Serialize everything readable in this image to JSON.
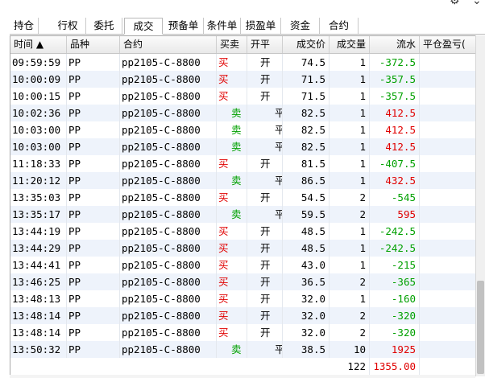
{
  "window_icons": [
    "gear-icon",
    "chevron-down-icon"
  ],
  "tabs": [
    {
      "label": "持仓",
      "active": false
    },
    {
      "label": "行权",
      "active": false
    },
    {
      "label": "委托",
      "active": false
    },
    {
      "label": "成交",
      "active": true
    },
    {
      "label": "预备单",
      "active": false
    },
    {
      "label": "条件单",
      "active": false
    },
    {
      "label": "损盈单",
      "active": false
    },
    {
      "label": "资金",
      "active": false
    },
    {
      "label": "合约",
      "active": false
    }
  ],
  "columns": [
    "时间 ▲",
    "品种",
    "合约",
    "买卖",
    "开平",
    "成交价",
    "成交量",
    "流水",
    "平仓盈亏("
  ],
  "rows": [
    {
      "time": "09:59:59",
      "product": "PP",
      "contract": "pp2105-C-8800",
      "side": "买",
      "openclose": "开",
      "price": "74.5",
      "qty": "1",
      "flow": "-372.5"
    },
    {
      "time": "10:00:09",
      "product": "PP",
      "contract": "pp2105-C-8800",
      "side": "买",
      "openclose": "开",
      "price": "71.5",
      "qty": "1",
      "flow": "-357.5"
    },
    {
      "time": "10:00:15",
      "product": "PP",
      "contract": "pp2105-C-8800",
      "side": "买",
      "openclose": "开",
      "price": "71.5",
      "qty": "1",
      "flow": "-357.5"
    },
    {
      "time": "10:02:36",
      "product": "PP",
      "contract": "pp2105-C-8800",
      "side": "卖",
      "openclose": "平",
      "price": "82.5",
      "qty": "1",
      "flow": "412.5"
    },
    {
      "time": "10:03:00",
      "product": "PP",
      "contract": "pp2105-C-8800",
      "side": "卖",
      "openclose": "平",
      "price": "82.5",
      "qty": "1",
      "flow": "412.5"
    },
    {
      "time": "10:03:00",
      "product": "PP",
      "contract": "pp2105-C-8800",
      "side": "卖",
      "openclose": "平",
      "price": "82.5",
      "qty": "1",
      "flow": "412.5"
    },
    {
      "time": "11:18:33",
      "product": "PP",
      "contract": "pp2105-C-8800",
      "side": "买",
      "openclose": "开",
      "price": "81.5",
      "qty": "1",
      "flow": "-407.5"
    },
    {
      "time": "11:20:12",
      "product": "PP",
      "contract": "pp2105-C-8800",
      "side": "卖",
      "openclose": "平",
      "price": "86.5",
      "qty": "1",
      "flow": "432.5"
    },
    {
      "time": "13:35:03",
      "product": "PP",
      "contract": "pp2105-C-8800",
      "side": "买",
      "openclose": "开",
      "price": "54.5",
      "qty": "2",
      "flow": "-545"
    },
    {
      "time": "13:35:17",
      "product": "PP",
      "contract": "pp2105-C-8800",
      "side": "卖",
      "openclose": "平",
      "price": "59.5",
      "qty": "2",
      "flow": "595"
    },
    {
      "time": "13:44:19",
      "product": "PP",
      "contract": "pp2105-C-8800",
      "side": "买",
      "openclose": "开",
      "price": "48.5",
      "qty": "1",
      "flow": "-242.5"
    },
    {
      "time": "13:44:29",
      "product": "PP",
      "contract": "pp2105-C-8800",
      "side": "买",
      "openclose": "开",
      "price": "48.5",
      "qty": "1",
      "flow": "-242.5"
    },
    {
      "time": "13:44:41",
      "product": "PP",
      "contract": "pp2105-C-8800",
      "side": "买",
      "openclose": "开",
      "price": "43.0",
      "qty": "1",
      "flow": "-215"
    },
    {
      "time": "13:46:25",
      "product": "PP",
      "contract": "pp2105-C-8800",
      "side": "买",
      "openclose": "开",
      "price": "36.5",
      "qty": "2",
      "flow": "-365"
    },
    {
      "time": "13:48:13",
      "product": "PP",
      "contract": "pp2105-C-8800",
      "side": "买",
      "openclose": "开",
      "price": "32.0",
      "qty": "1",
      "flow": "-160"
    },
    {
      "time": "13:48:14",
      "product": "PP",
      "contract": "pp2105-C-8800",
      "side": "买",
      "openclose": "开",
      "price": "32.0",
      "qty": "2",
      "flow": "-320"
    },
    {
      "time": "13:48:14",
      "product": "PP",
      "contract": "pp2105-C-8800",
      "side": "买",
      "openclose": "开",
      "price": "32.0",
      "qty": "2",
      "flow": "-320"
    },
    {
      "time": "13:50:32",
      "product": "PP",
      "contract": "pp2105-C-8800",
      "side": "卖",
      "openclose": "平",
      "price": "38.5",
      "qty": "10",
      "flow": "1925"
    }
  ],
  "totals": {
    "qty": "122",
    "flow": "1355.00"
  },
  "colors": {
    "buy": "#e00000",
    "sell": "#00a000",
    "row_alt": "#eef3fb"
  }
}
